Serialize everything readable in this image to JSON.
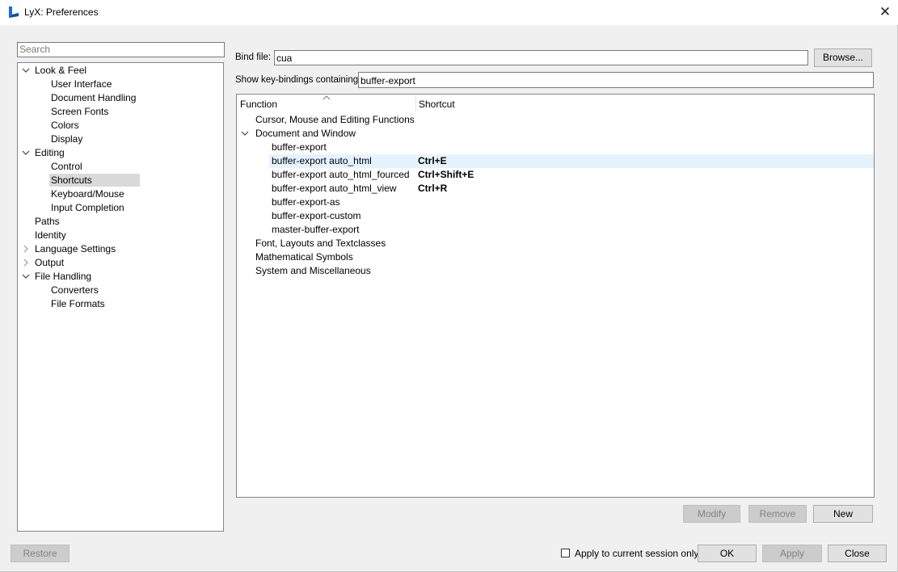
{
  "window": {
    "title": "LyX: Preferences",
    "close_glyph": "✕"
  },
  "sidebar": {
    "search_placeholder": "Search",
    "tree": [
      {
        "label": "Look & Feel",
        "level": 0,
        "arrow": "expanded"
      },
      {
        "label": "User Interface",
        "level": 1
      },
      {
        "label": "Document Handling",
        "level": 1
      },
      {
        "label": "Screen Fonts",
        "level": 1
      },
      {
        "label": "Colors",
        "level": 1
      },
      {
        "label": "Display",
        "level": 1
      },
      {
        "label": "Editing",
        "level": 0,
        "arrow": "expanded"
      },
      {
        "label": "Control",
        "level": 1
      },
      {
        "label": "Shortcuts",
        "level": 1,
        "selected": true
      },
      {
        "label": "Keyboard/Mouse",
        "level": 1
      },
      {
        "label": "Input Completion",
        "level": 1
      },
      {
        "label": "Paths",
        "level": 0
      },
      {
        "label": "Identity",
        "level": 0
      },
      {
        "label": "Language Settings",
        "level": 0,
        "arrow": "collapsed"
      },
      {
        "label": "Output",
        "level": 0,
        "arrow": "collapsed"
      },
      {
        "label": "File Handling",
        "level": 0,
        "arrow": "expanded"
      },
      {
        "label": "Converters",
        "level": 1
      },
      {
        "label": "File Formats",
        "level": 1
      }
    ]
  },
  "bind_file": {
    "label": "Bind file:",
    "value": "cua",
    "browse_label": "Browse..."
  },
  "filter": {
    "label": "Show key-bindings containing:",
    "value": "buffer-export"
  },
  "table": {
    "headers": {
      "function": "Function",
      "shortcut": "Shortcut"
    },
    "rows": [
      {
        "function": "Cursor, Mouse and Editing Functions",
        "level": 0
      },
      {
        "function": "Document and Window",
        "level": 0,
        "arrow": "expanded"
      },
      {
        "function": "buffer-export",
        "level": 1
      },
      {
        "function": "buffer-export auto_html",
        "level": 1,
        "shortcut": "Ctrl+E",
        "highlighted": true
      },
      {
        "function": "buffer-export auto_html_fourced",
        "level": 1,
        "shortcut": "Ctrl+Shift+E"
      },
      {
        "function": "buffer-export auto_html_view",
        "level": 1,
        "shortcut": "Ctrl+R"
      },
      {
        "function": "buffer-export-as",
        "level": 1
      },
      {
        "function": "buffer-export-custom",
        "level": 1
      },
      {
        "function": "master-buffer-export",
        "level": 1
      },
      {
        "function": "Font, Layouts and Textclasses",
        "level": 0
      },
      {
        "function": "Mathematical Symbols",
        "level": 0
      },
      {
        "function": "System and Miscellaneous",
        "level": 0
      }
    ]
  },
  "actions": {
    "modify": "Modify",
    "remove": "Remove",
    "new": "New"
  },
  "footer": {
    "restore": "Restore",
    "session_only": "Apply to current session only",
    "ok": "OK",
    "apply": "Apply",
    "close": "Close"
  },
  "colors": {
    "logo_blue": "#1a6fd6",
    "highlight_row": "#e5f3ff",
    "selected_item": "#d9d9d9"
  }
}
